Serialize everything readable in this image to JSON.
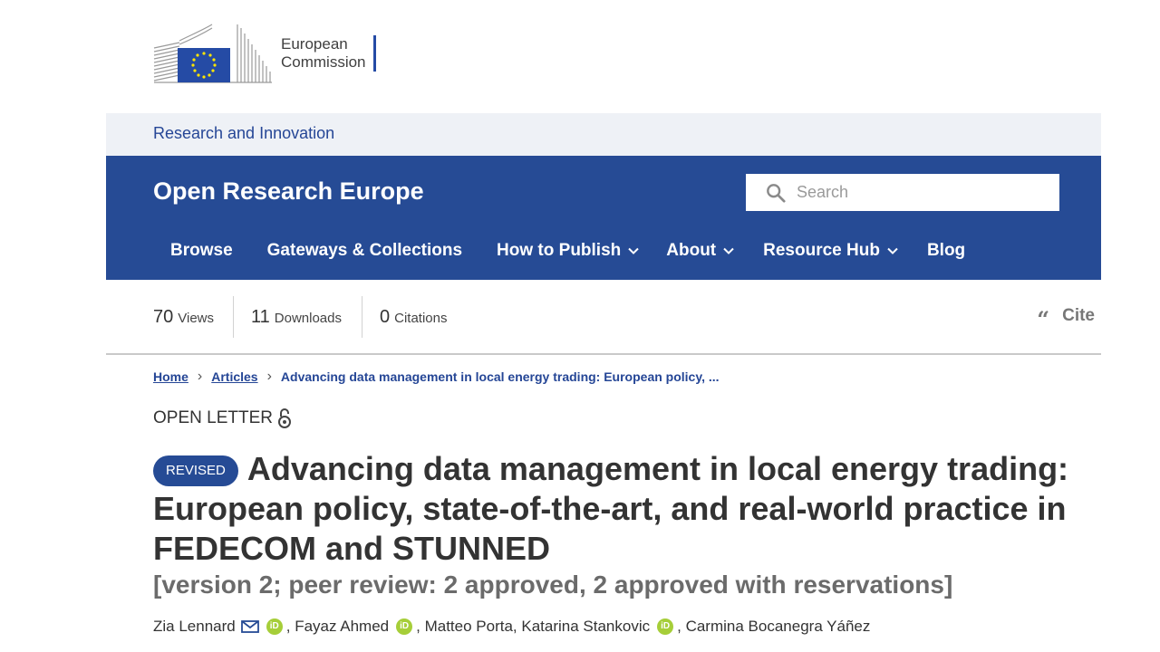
{
  "ec_logo": {
    "line1": "European",
    "line2": "Commission"
  },
  "ri_band": {
    "label": "Research and Innovation"
  },
  "site": {
    "title": "Open Research Europe",
    "search_placeholder": "Search",
    "nav": [
      {
        "label": "Browse",
        "has_dropdown": false
      },
      {
        "label": "Gateways & Collections",
        "has_dropdown": false
      },
      {
        "label": "How to Publish",
        "has_dropdown": true
      },
      {
        "label": "About",
        "has_dropdown": true
      },
      {
        "label": "Resource Hub",
        "has_dropdown": true
      },
      {
        "label": "Blog",
        "has_dropdown": false
      }
    ]
  },
  "metrics": {
    "views": {
      "count": "70",
      "label": "Views"
    },
    "downloads": {
      "count": "11",
      "label": "Downloads"
    },
    "citations": {
      "count": "0",
      "label": "Citations"
    },
    "cite_label": "Cite"
  },
  "breadcrumb": {
    "home": "Home",
    "articles": "Articles",
    "current": "Advancing data management in local energy trading: European policy, ..."
  },
  "article": {
    "type": "OPEN LETTER",
    "badge": "REVISED",
    "title": "Advancing data management in local energy trading: European policy, state-of-the-art, and real-world practice in FEDECOM and STUNNED",
    "version": "[version 2; peer review: 2 approved, 2 approved with reservations]",
    "authors": [
      {
        "name": "Zia Lennard",
        "email": true,
        "orcid": true
      },
      {
        "name": "Fayaz Ahmed",
        "email": false,
        "orcid": true
      },
      {
        "name": "Matteo Porta",
        "email": false,
        "orcid": false
      },
      {
        "name": "Katarina Stankovic",
        "email": false,
        "orcid": true
      },
      {
        "name": "Carmina Bocanegra Yáñez",
        "email": false,
        "orcid": false
      }
    ],
    "orcid_text": "iD"
  },
  "colors": {
    "brand_blue": "#264b95",
    "link_blue": "#254696",
    "orcid_green": "#a6ce39",
    "band_gray": "#eef1f6"
  }
}
